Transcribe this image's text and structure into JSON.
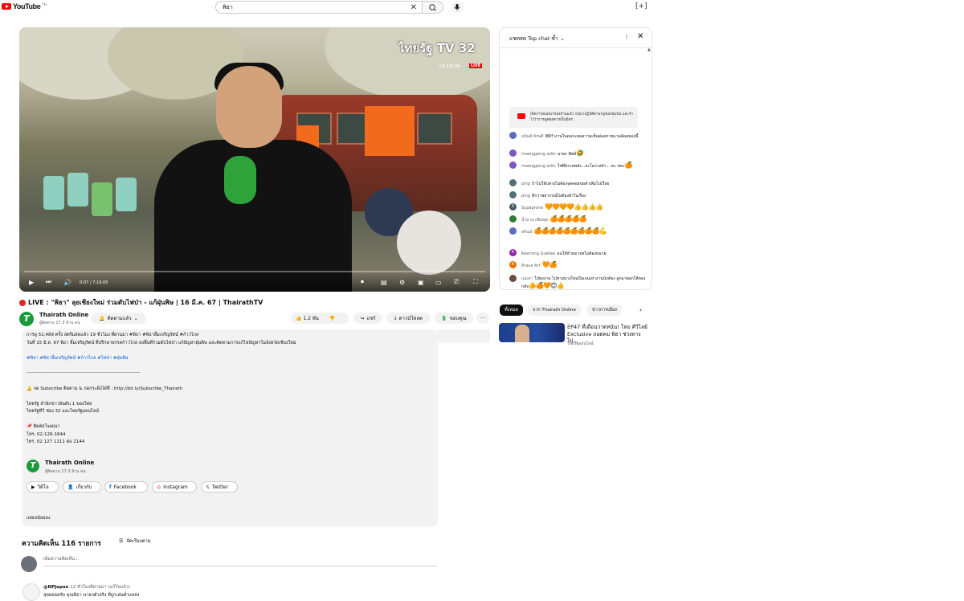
{
  "topbar": {
    "logo_text": "YouTube",
    "logo_country": "TH",
    "search_value": "พิธา",
    "top_right_label": "[+]"
  },
  "player": {
    "channel_watermark": "ไทยรัฐ TV 32",
    "clock": "18:18:36",
    "live_badge": "LIVE",
    "time_readout": "0:07 / 7:19:05",
    "progress": 0.0,
    "colors": {
      "accent": "#f26a1b",
      "live": "#ee0000",
      "mic": "#2fa23a"
    }
  },
  "video": {
    "title": "LIVE : \"พิธา\" ลุยเชียงใหม่ ร่วมดับไฟป่า - แก้ฝุ่นพิษ | 16 มี.ค. 67 | ThairathTV",
    "channel_initial": "T",
    "channel_name": "Thairath Online",
    "subscribers": "ผู้ติดตาม 17.3 ล้าน คน",
    "subscribed_label": "ติดตามแล้ว",
    "like_count": "1.2 พัน",
    "share_label": "แชร์",
    "download_label": "ดาวน์โหลด",
    "thanks_label": "ขอบคุณ",
    "more_label": "···"
  },
  "description": {
    "lines": [
      {
        "text": "การดู 51,489 ครั้ง  สตรีมสดแล้ว 19 ชั่วโมง ที่ผ่านมา  #พิธา #พิธาลิ้มเจริญรัตน์ #ก้าวไกล",
        "link": false
      },
      {
        "text": "วันที่ 15 มี.ค. 67 พิธา ลิ้มเจริญรัตน์ ที่ปรึกษาพรรคก้าวไกล ลงพื้นที่ร่วมดับไฟป่า แก้ปัญหาฝุ่นพิษ และติดตามการแก้ไขปัญหาในจังหวัดเชียงใหม่",
        "link": false
      },
      {
        "text": "#พิธา #พิธาลิ้มเจริญรัตน์ #ก้าวไกล #ไฟป่า #ฝุ่นพิษ",
        "link": true
      },
      {
        "text": "-----------------------------------------------------------------------",
        "link": false
      },
      {
        "text": "🔔 กด Subscribe ติดตาม & กดกระดิ่งได้ที่ : http://bit.ly/Subscribe_Thairath",
        "link": false
      },
      {
        "text": "ไทยรัฐ สำนักข่าวอันดับ 1 ของไทย",
        "link": false
      },
      {
        "text": "ไทยรัฐทีวี ช่อง 32 และไทยรัฐออนไลน์",
        "link": false
      },
      {
        "text": "📌 ติดต่อโฆษณา",
        "link": false
      },
      {
        "text": "โทร. 02-126-1644",
        "link": false
      },
      {
        "text": "ไทร. 02 127 1111 ต่อ 2144",
        "link": false
      }
    ],
    "channel_name": "Thairath Online",
    "channel_subs": "ผู้ติดตาม 17.3 ล้าน คน",
    "buttons": [
      {
        "label": "วิดีโอ",
        "icon": "video-icon"
      },
      {
        "label": "เกี่ยวกับ",
        "icon": "about-icon"
      },
      {
        "label": "Facebook",
        "icon": "facebook-icon"
      },
      {
        "label": "Instagram",
        "icon": "instagram-icon"
      },
      {
        "label": "Twitter",
        "icon": "twitter-icon"
      }
    ],
    "show_less": "แสดงน้อยลง"
  },
  "comments": {
    "count_label": "ความคิดเห็น 116 รายการ",
    "sort_label": "จัดเรียงตาม",
    "add_placeholder": "เพิ่มความคิดเห็น...",
    "first": {
      "author": "@NPJapan",
      "time": "12 ชั่วโมงที่ผ่านมา (แก้ไขแล้ว)",
      "text": "สุดยอดครับ คุณพิธา นายกตัวจริง ที่ถูกเล่นต่ำแหล่ง"
    }
  },
  "chat": {
    "header": "แชทสด Top chat ซ้ำ",
    "banner": "เปิดการสนทนาของท่านแล้ว กรุณาปฏิบัติตามกฎของชุมชน และจำไว้ว่าการพูดคุยควรเป็นมิตร",
    "messages": [
      {
        "author": "อนันต์ ทักษดี",
        "text": "พิธีกำงานในคนระดมความเห็นต่อสภาพแวดล้อมของนี้",
        "emoji": "",
        "color": "#5c6bc0",
        "initial": ""
      },
      {
        "author": "maengpeng adm",
        "text": "นายก พิพธ์",
        "emoji": "🤣",
        "color": "#7e57c2",
        "initial": ""
      },
      {
        "author": "maengpeng adm",
        "text": "ใช่ที่ท่งาคพลัง...จะโอกาสจำ... คะ ทหะ",
        "emoji": "🍊",
        "color": "#7e57c2",
        "initial": ""
      },
      {
        "author": "ping",
        "text": "ถ้าไม่ให้ปลายไม่ต้องจุดคอยขอดำเพิ่มไปเรื่อย",
        "emoji": "",
        "color": "#546e7a",
        "initial": ""
      },
      {
        "author": "ping",
        "text": "ดีกว่าพยากรณ์ไม่ต้องยำในเรื่อง",
        "emoji": "",
        "color": "#546e7a",
        "initial": ""
      },
      {
        "author": "Supaprone",
        "text": "",
        "emoji": "🧡🧡🧡🧡👍👍👍👍",
        "color": "#455a64",
        "initial": "S"
      },
      {
        "author": "น้ำยาน เพียงผุด",
        "text": "",
        "emoji": "🍊🍊🍊🍊🍊",
        "color": "#2e7d32",
        "initial": ""
      },
      {
        "author": "สกิณย์",
        "text": "",
        "emoji": "🍊🍊🍊🍊🍊🍊🍊🍊🍊💪",
        "color": "#5c6bc0",
        "initial": ""
      },
      {
        "author": "Keerlong Guelwe",
        "text": "อนให้หัวหมาจหไม่ต้องหนาย",
        "emoji": "",
        "color": "#8e24aa",
        "initial": "K"
      },
      {
        "author": "Brave Art",
        "text": "",
        "emoji": "🧡🍊",
        "color": "#ef6c00",
        "initial": "B"
      },
      {
        "author": "แม่เล่า",
        "text": "ไปพุงงาน ไปทายนางใหม่ปั่นเจนเท่างานนักต้อง ลูกมาตอกให้หลงกลับ",
        "emoji": "🫵🍊🧡😊👍",
        "color": "#6d4c41",
        "initial": ""
      }
    ]
  },
  "chips": [
    {
      "label": "ทั้งหมด",
      "active": true
    },
    {
      "label": "จาก Thairath Online",
      "active": false
    },
    {
      "label": "ข่าวการเมือง",
      "active": false
    }
  ],
  "related": {
    "title": "EP47 ที่เดือนวาดหนัน! โหม ศิวิไลย์ Exclusive ถอดคม พิธา ช่วงทางไป...",
    "channel": "ไทยรัฐออนไลน์"
  }
}
